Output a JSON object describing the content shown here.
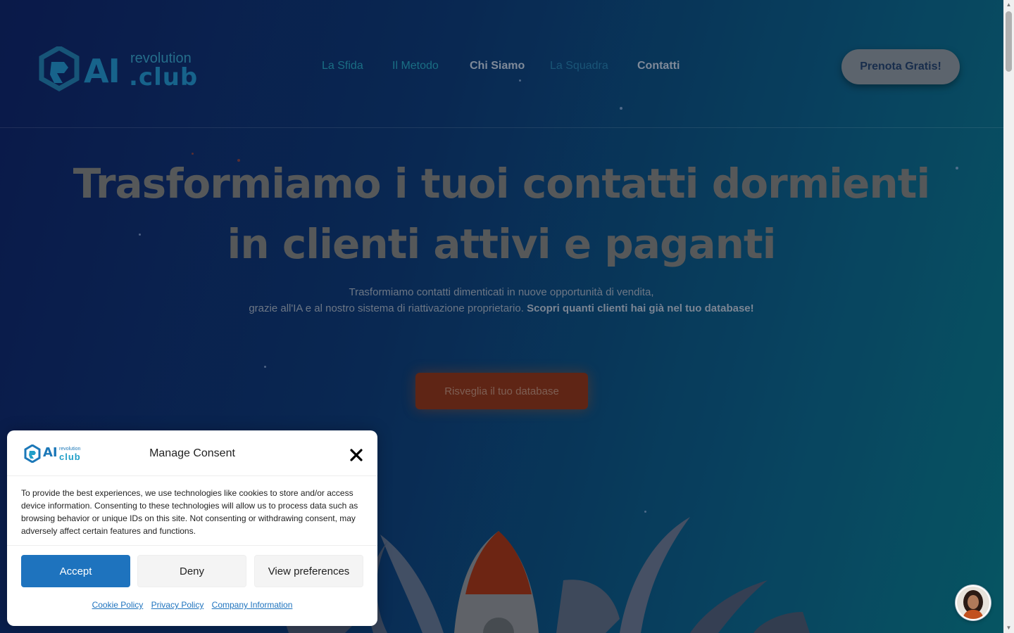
{
  "header": {
    "logo": {
      "ai": "AI",
      "revolution": "revolution",
      "club": ".club"
    },
    "nav": [
      {
        "label": "La Sfida"
      },
      {
        "label": "Il Metodo"
      },
      {
        "label": "Chi Siamo"
      },
      {
        "label": "La Squadra"
      },
      {
        "label": "Contatti"
      }
    ],
    "cta_label": "Prenota Gratis!"
  },
  "hero": {
    "title_line1": "Trasformiamo i tuoi contatti dormienti",
    "title_line2": "in clienti attivi e paganti",
    "sub_line1": "Trasformiamo contatti dimenticati in nuove opportunità di vendita,",
    "sub_line2": "grazie all'IA e al nostro sistema di riattivazione proprietario.",
    "sub_bold": "Scopri quanti clienti hai già nel tuo database!",
    "cta_label": "Risveglia il tuo database"
  },
  "consent": {
    "logo": {
      "ai": "AI",
      "revolution": "revolution",
      "club": "club"
    },
    "title": "Manage Consent",
    "body": "To provide the best experiences, we use technologies like cookies to store and/or access device information. Consenting to these technologies will allow us to process data such as browsing behavior or unique IDs on this site. Not consenting or withdrawing consent, may adversely affect certain features and functions.",
    "accept_label": "Accept",
    "deny_label": "Deny",
    "preferences_label": "View preferences",
    "links": {
      "cookie_policy": "Cookie Policy",
      "privacy_policy": "Privacy Policy",
      "company_info": "Company Information"
    }
  },
  "colors": {
    "accent": "#1e73be",
    "cta_orange": "#c2501e",
    "brand_teal": "#1a6f9b"
  }
}
